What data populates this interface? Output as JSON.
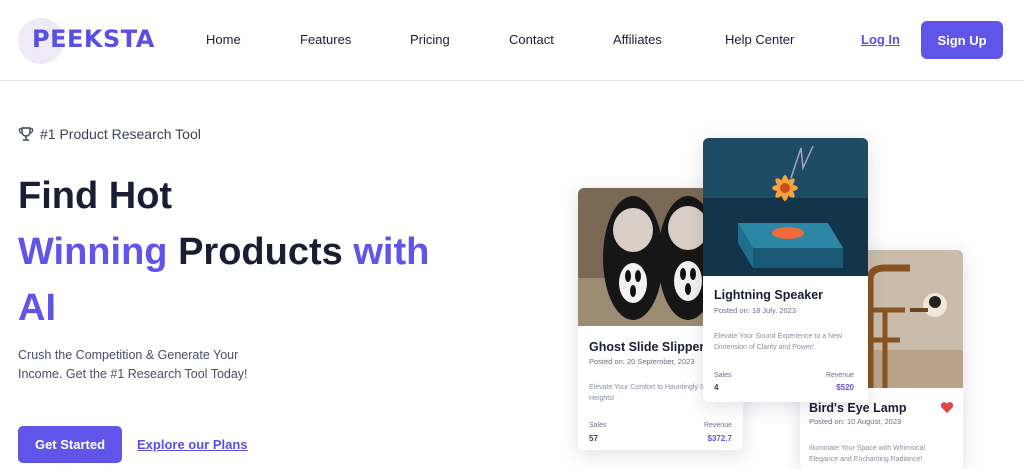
{
  "brand": {
    "name": "PEEKSTA",
    "accent": "#6154e8"
  },
  "nav": {
    "items": [
      "Home",
      "Features",
      "Pricing",
      "Contact",
      "Affiliates",
      "Help Center"
    ],
    "login": "Log In",
    "signup": "Sign Up"
  },
  "hero": {
    "badge": "#1 Product Research Tool",
    "line1": "Find Hot",
    "line2_accent": "Winning",
    "line2_main": "Products",
    "line2_end": "with",
    "line3": "AI",
    "subtext": "Crush the Competition & Generate Your Income. Get the #1 Research Tool Today!",
    "cta_primary": "Get Started",
    "cta_secondary": "Explore our Plans"
  },
  "products": [
    {
      "name": "Ghost Slide Slippers",
      "posted": "Posted on: 20 September, 2023",
      "description": "Elevate Your Comfort to Hauntingly Stylish Heights!",
      "sales_label": "Sales",
      "sales": "57",
      "revenue_label": "Revenue",
      "revenue": "$372.7"
    },
    {
      "name": "Lightning Speaker",
      "posted": "Posted on: 18 July, 2023",
      "description": "Elevate Your Sound Experience to a New Dimension of Clarity and Power!",
      "sales_label": "Sales",
      "sales": "4",
      "revenue_label": "Revenue",
      "revenue": "$520"
    },
    {
      "name": "Bird's Eye Lamp",
      "posted": "Posted on: 10 August, 2023",
      "description": "Illuminate Your Space with Whimsical Elegance and Enchanting Radiance!"
    }
  ]
}
